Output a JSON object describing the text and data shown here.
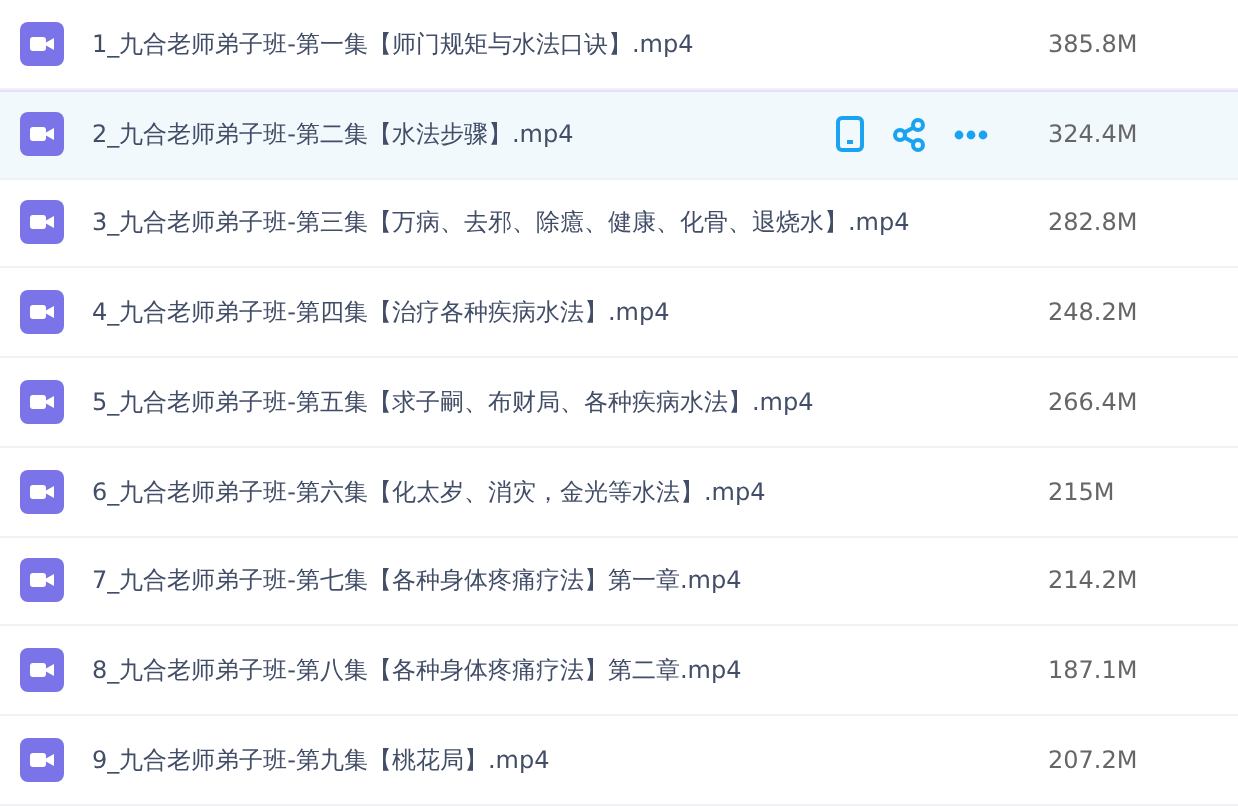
{
  "files": [
    {
      "name": "1_九合老师弟子班-第一集【师门规矩与水法口诀】.mp4",
      "size": "385.8M",
      "hovered": false
    },
    {
      "name": "2_九合老师弟子班-第二集【水法步骤】.mp4",
      "size": "324.4M",
      "hovered": true
    },
    {
      "name": "3_九合老师弟子班-第三集【万病、去邪、除癔、健康、化骨、退烧水】.mp4",
      "size": "282.8M",
      "hovered": false
    },
    {
      "name": "4_九合老师弟子班-第四集【治疗各种疾病水法】.mp4",
      "size": "248.2M",
      "hovered": false
    },
    {
      "name": "5_九合老师弟子班-第五集【求子嗣、布财局、各种疾病水法】.mp4",
      "size": "266.4M",
      "hovered": false
    },
    {
      "name": "6_九合老师弟子班-第六集【化太岁、消灾，金光等水法】.mp4",
      "size": "215M",
      "hovered": false
    },
    {
      "name": "7_九合老师弟子班-第七集【各种身体疼痛疗法】第一章.mp4",
      "size": "214.2M",
      "hovered": false
    },
    {
      "name": "8_九合老师弟子班-第八集【各种身体疼痛疗法】第二章.mp4",
      "size": "187.1M",
      "hovered": false
    },
    {
      "name": "9_九合老师弟子班-第九集【桃花局】.mp4",
      "size": "207.2M",
      "hovered": false
    }
  ]
}
